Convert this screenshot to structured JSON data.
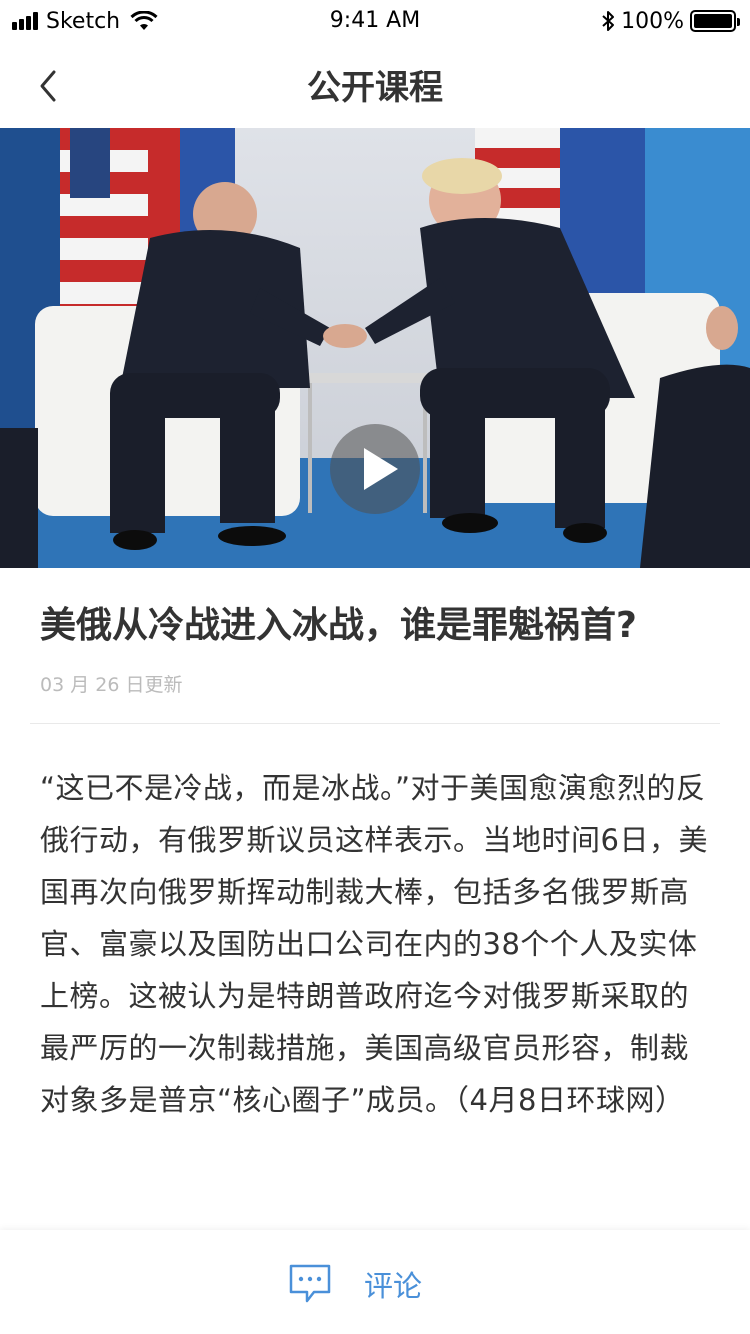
{
  "status_bar": {
    "carrier": "Sketch",
    "time": "9:41 AM",
    "battery": "100%",
    "battery_level": 1.0,
    "icons": [
      "signal-icon",
      "wifi-icon",
      "bluetooth-icon",
      "battery-icon"
    ]
  },
  "nav": {
    "title": "公开课程",
    "back_icon": "chevron-left-icon"
  },
  "video": {
    "play_icon": "play-icon"
  },
  "article": {
    "title": "美俄从冷战进入冰战，谁是罪魁祸首?",
    "updated": "03 月 26 日更新",
    "body": "“这已不是冷战，而是冰战。”对于美国愈演愈烈的反俄行动，有俄罗斯议员这样表示。当地时间6日，美国再次向俄罗斯挥动制裁大棒，包括多名俄罗斯高官、富豪以及国防出口公司在内的38个个人及实体上榜。这被认为是特朗普政府迄今对俄罗斯采取的最严厉的一次制裁措施，美国高级官员形容，制裁对象多是普京“核心圈子”成员。（4月8日环球网）"
  },
  "bottom": {
    "comment_label": "评论",
    "comment_icon": "comment-icon"
  },
  "colors": {
    "accent": "#4a90d9",
    "text": "#333333",
    "muted": "#bbbbbb",
    "divider": "#e9e9e9"
  }
}
